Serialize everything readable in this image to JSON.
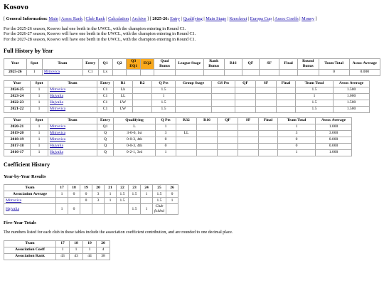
{
  "title": "Kosovo",
  "nav": {
    "general_label": "General Information:",
    "general_links": [
      "Main",
      "Assoc Rank",
      "Club Rank",
      "Calculation",
      "Archive"
    ],
    "season_label": "2025-26",
    "season_links": [
      "Entry",
      "Qualifying",
      "Main Stage",
      "Knockout",
      "Europa Cup",
      "Assoc Coeffs",
      "Money"
    ]
  },
  "notes": [
    "For the 2025-26 season, Kosovo had one berth in the UWCL, with the champion entering in Round C1.",
    "For the 2026-27 season, Kosovo will have one berth in the UWCL, with the champion entering in Round C1.",
    "For the 2027-28 season, Kosovo will have one berth in the UWCL, with the champion entering in Round C1."
  ],
  "full_history": {
    "heading": "Full History by Year",
    "table1": {
      "headers": [
        "Year",
        "Spot",
        "Team",
        "Entry",
        "Q1",
        "Q2",
        "Q3 EQ1",
        "EQ2",
        "Qual Bonus",
        "League Stage",
        "Rank Bonus",
        "R16",
        "QF",
        "SF",
        "Final",
        "Round Bonus",
        "Team Total",
        "Assoc Average"
      ],
      "rows": [
        [
          "2025-26",
          "1",
          "Mitrovica",
          "C1",
          "Lx",
          "",
          "",
          "",
          "",
          "",
          "",
          "",
          "",
          "",
          "",
          "",
          "0",
          "0.000"
        ]
      ]
    },
    "table2": {
      "headers": [
        "Year",
        "Spot",
        "Team",
        "Entry",
        "R1",
        "R2",
        "Q Pts",
        "Group Stage",
        "GS Pts",
        "QF",
        "SF",
        "Final",
        "Team Total",
        "Assoc Average"
      ],
      "rows": [
        [
          "2024-25",
          "1",
          "Mitrovica",
          "C1",
          "Lh",
          "",
          "1.5",
          "",
          "",
          "",
          "",
          "",
          "1.5",
          "1.500"
        ],
        [
          "2023-24",
          "1",
          "Hajvalia",
          "C1",
          "LL",
          "",
          "1",
          "",
          "",
          "",
          "",
          "",
          "1",
          "1.000"
        ],
        [
          "2022-23",
          "1",
          "Hajvalia",
          "C1",
          "LW",
          "",
          "1.5",
          "",
          "",
          "",
          "",
          "",
          "1.5",
          "1.500"
        ],
        [
          "2021-22",
          "1",
          "Mitrovica",
          "C1",
          "LW",
          "",
          "1.5",
          "",
          "",
          "",
          "",
          "",
          "1.5",
          "1.500"
        ]
      ]
    },
    "table3": {
      "headers": [
        "Year",
        "Spot",
        "Team",
        "Entry",
        "Qualifying",
        "Q Pts",
        "R32",
        "R16",
        "QF",
        "SF",
        "Final",
        "Team Total",
        "Assoc Average"
      ],
      "rows": [
        [
          "2020-21",
          "1",
          "Mitrovica",
          "Q1",
          "L",
          "1",
          "",
          "",
          "",
          "",
          "",
          "1",
          "1.000"
        ],
        [
          "2019-20",
          "1",
          "Mitrovica",
          "Q",
          "3-0-0, 1st",
          "3",
          "LL",
          "",
          "",
          "",
          "",
          "3",
          "3.000"
        ],
        [
          "2018-19",
          "1",
          "Mitrovica",
          "Q",
          "0-0-3, 4th",
          "0",
          "",
          "",
          "",
          "",
          "",
          "0",
          "0.000"
        ],
        [
          "2017-18",
          "1",
          "Hajvalia",
          "Q",
          "0-0-3, 4th",
          "0",
          "",
          "",
          "",
          "",
          "",
          "0",
          "0.000"
        ],
        [
          "2016-17",
          "1",
          "Hajvalia",
          "Q",
          "0-2-1, 3rd",
          "1",
          "",
          "",
          "",
          "",
          "",
          "1",
          "1.000"
        ]
      ]
    }
  },
  "coefficient": {
    "heading": "Coefficient History",
    "yby_heading": "Year-by-Year Results",
    "yby_headers": [
      "Team",
      "17",
      "18",
      "19",
      "20",
      "21",
      "22",
      "23",
      "24",
      "25",
      "26"
    ],
    "yby_rows": [
      [
        "Association Average",
        "1",
        "0",
        "0",
        "3",
        "1",
        "1.5",
        "1.5",
        "1",
        "1.5",
        "0"
      ],
      [
        "Mitrovica",
        "",
        "",
        "0",
        "3",
        "1",
        "1.5",
        "",
        "",
        "1.5",
        "1"
      ],
      [
        "Hajvalia",
        "1",
        "0",
        "",
        "",
        "",
        "",
        "1.5",
        "1",
        "Club folded",
        ""
      ]
    ],
    "five_heading": "Five-Year Totals",
    "five_note": "The numbers listed for each club in these tables include the association coefficient contribution, and are rounded to one decimal place.",
    "five_headers": [
      "Team",
      "17",
      "18",
      "19",
      "20"
    ],
    "five_rows": [
      [
        "Association Coeff",
        "1",
        "1",
        "1",
        "4"
      ],
      [
        "Association Rank",
        "43",
        "43",
        "44",
        "38"
      ]
    ]
  }
}
